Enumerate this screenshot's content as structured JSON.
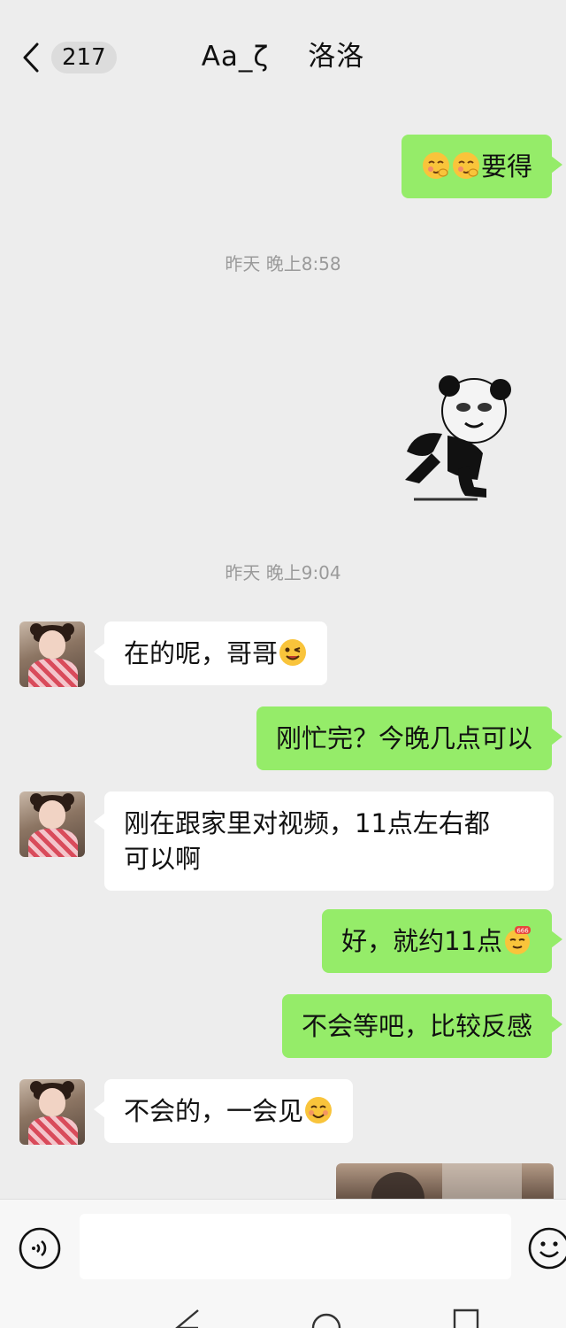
{
  "header": {
    "unread_count": "217",
    "title_part1": "Aa_ζ",
    "title_part2": "洛洛"
  },
  "messages": {
    "m1": {
      "side": "out",
      "text": "要得",
      "emojis": [
        "shy-face-emoji",
        "shy-face-emoji"
      ]
    },
    "ts1": "昨天 晚上8:58",
    "sticker": {
      "name": "panda-meme-sticker"
    },
    "ts2": "昨天 晚上9:04",
    "m2": {
      "side": "in",
      "text": "在的呢，哥哥",
      "emoji": "wink-emoji"
    },
    "m3": {
      "side": "out",
      "text": "刚忙完？今晚几点可以"
    },
    "m4": {
      "side": "in",
      "line1": "刚在跟家里对视频，11点左右都",
      "line2": "可以啊"
    },
    "m5": {
      "side": "out",
      "text": "好，就约11点",
      "emoji": "666-emoji"
    },
    "m6": {
      "side": "out",
      "text": "不会等吧，比较反感"
    },
    "m7": {
      "side": "in",
      "text": "不会的，一会见",
      "emoji": "smile-emoji"
    },
    "m8": {
      "side": "out",
      "type": "photo"
    }
  },
  "input_bar": {
    "voice_icon": "voice-icon",
    "placeholder": "",
    "emoji_icon": "emoji-icon"
  },
  "colors": {
    "outgoing_bubble": "#95ec69",
    "incoming_bubble": "#ffffff",
    "background": "#ededed"
  }
}
